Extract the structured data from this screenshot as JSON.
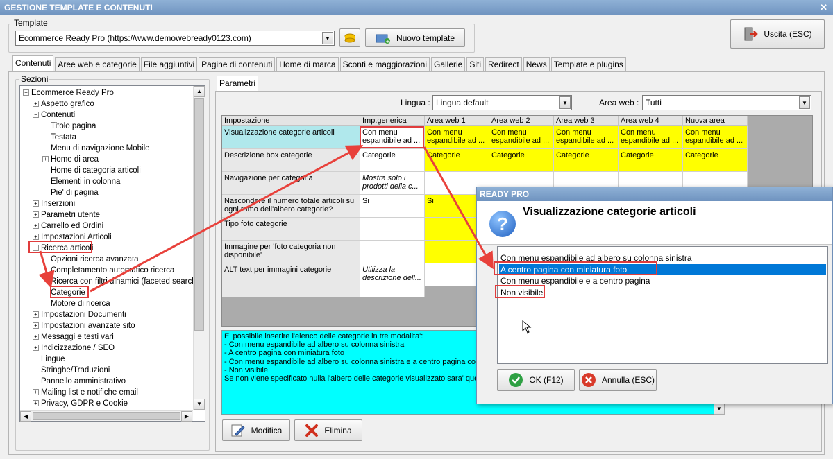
{
  "window": {
    "title": "GESTIONE TEMPLATE E CONTENUTI",
    "close": "✕"
  },
  "template": {
    "group_label": "Template",
    "selected": "Ecommerce Ready Pro (https://www.demowebready0123.com)",
    "new_button": "Nuovo template",
    "exit_button": "Uscita (ESC)"
  },
  "tabs": [
    "Contenuti",
    "Aree web e categorie",
    "File aggiuntivi",
    "Pagine di contenuti",
    "Home di marca",
    "Sconti e maggiorazioni",
    "Gallerie",
    "Siti",
    "Redirect",
    "News",
    "Template e plugins"
  ],
  "sections": {
    "label": "Sezioni",
    "tree": [
      {
        "label": "Ecommerce Ready Pro",
        "level": 0,
        "exp": "−"
      },
      {
        "label": "Aspetto grafico",
        "level": 1,
        "exp": "+"
      },
      {
        "label": "Contenuti",
        "level": 1,
        "exp": "−"
      },
      {
        "label": "Titolo pagina",
        "level": 2,
        "exp": ""
      },
      {
        "label": "Testata",
        "level": 2,
        "exp": ""
      },
      {
        "label": "Menu di navigazione Mobile",
        "level": 2,
        "exp": ""
      },
      {
        "label": "Home di area",
        "level": 2,
        "exp": "+"
      },
      {
        "label": "Home di categoria articoli",
        "level": 2,
        "exp": ""
      },
      {
        "label": "Elementi in colonna",
        "level": 2,
        "exp": ""
      },
      {
        "label": "Pie' di pagina",
        "level": 2,
        "exp": ""
      },
      {
        "label": "Inserzioni",
        "level": 1,
        "exp": "+"
      },
      {
        "label": "Parametri utente",
        "level": 1,
        "exp": "+"
      },
      {
        "label": "Carrello ed Ordini",
        "level": 1,
        "exp": "+"
      },
      {
        "label": "Impostazioni Articoli",
        "level": 1,
        "exp": "+"
      },
      {
        "label": "Ricerca articoli",
        "level": 1,
        "exp": "−"
      },
      {
        "label": "Opzioni ricerca avanzata",
        "level": 2,
        "exp": ""
      },
      {
        "label": "Completamento automatico ricerca",
        "level": 2,
        "exp": ""
      },
      {
        "label": "Ricerca con filtri dinamici (faceted search)",
        "level": 2,
        "exp": ""
      },
      {
        "label": "Categorie",
        "level": 2,
        "exp": ""
      },
      {
        "label": "Motore di ricerca",
        "level": 2,
        "exp": ""
      },
      {
        "label": "Impostazioni Documenti",
        "level": 1,
        "exp": "+"
      },
      {
        "label": "Impostazioni avanzate sito",
        "level": 1,
        "exp": "+"
      },
      {
        "label": "Messaggi e testi vari",
        "level": 1,
        "exp": "+"
      },
      {
        "label": "Indicizzazione / SEO",
        "level": 1,
        "exp": "+"
      },
      {
        "label": "Lingue",
        "level": 1,
        "exp": ""
      },
      {
        "label": "Stringhe/Traduzioni",
        "level": 1,
        "exp": ""
      },
      {
        "label": "Pannello amministrativo",
        "level": 1,
        "exp": ""
      },
      {
        "label": "Mailing list e notifiche email",
        "level": 1,
        "exp": "+"
      },
      {
        "label": "Privacy, GDPR e Cookie",
        "level": 1,
        "exp": "+"
      }
    ]
  },
  "params": {
    "tab": "Parametri",
    "lingua_label": "Lingua :",
    "lingua_value": "Lingua default",
    "area_label": "Area web :",
    "area_value": "Tutti",
    "columns": [
      "Impostazione",
      "Imp.generica",
      "Area web 1",
      "Area web 2",
      "Area web 3",
      "Area web 4",
      "Nuova area"
    ],
    "rows": [
      {
        "name": "Visualizzazione categorie articoli",
        "generic": "Con menu espandibile ad ...",
        "areas": [
          "Con menu espandibile ad ...",
          "Con menu espandibile ad ...",
          "Con menu espandibile ad ...",
          "Con menu espandibile ad ...",
          "Con menu espandibile ad ..."
        ]
      },
      {
        "name": "Descrizione box categorie",
        "generic": "Categorie",
        "areas": [
          "Categorie",
          "Categorie",
          "Categorie",
          "Categorie",
          "Categorie"
        ]
      },
      {
        "name": "Navigazione per categoria",
        "generic": "Mostra solo i prodotti della c...",
        "areas": [
          "",
          "",
          "",
          "",
          ""
        ]
      },
      {
        "name": "Nascondere il numero totale articoli su ogni ramo dell'albero categorie?",
        "generic": "Si",
        "areas": [
          "Si",
          "",
          "",
          "",
          ""
        ]
      },
      {
        "name": "Tipo foto categorie",
        "generic": "",
        "areas": [
          "",
          "",
          "",
          "",
          ""
        ]
      },
      {
        "name": "Immagine per 'foto categoria non disponibile'",
        "generic": "",
        "areas": [
          "",
          "",
          "",
          "",
          ""
        ]
      },
      {
        "name": "ALT text per immagini categorie",
        "generic": "Utilizza la descrizione dell...",
        "areas": [
          "",
          "",
          "",
          "",
          ""
        ]
      }
    ],
    "description": [
      "E' possibile inserire l'elenco delle categorie in tre modalita':",
      "- Con menu espandibile ad albero su colonna sinistra",
      "- A centro pagina con miniatura foto",
      "- Con menu espandibile ad albero su colonna sinistra e a centro pagina con m",
      "- Non visibile",
      "Se non viene specificato nulla l'albero delle categorie visualizzato sara' quello"
    ],
    "edit_button": "Modifica",
    "delete_button": "Elimina"
  },
  "dialog": {
    "title": "READY PRO",
    "heading": "Visualizzazione categorie articoli",
    "options": [
      "Con menu espandibile ad albero su colonna sinistra",
      "A centro pagina con miniatura foto",
      "Con menu espandibile e a centro pagina",
      "Non visibile"
    ],
    "selected_index": 1,
    "ok_button": "OK (F12)",
    "cancel_button": "Annulla (ESC)"
  },
  "colors": {
    "accent": "#0078d7",
    "highlight_red": "#e03c3c",
    "yellow": "#ffff00",
    "cyan": "#00ffff",
    "selected_row": "#b0e8ec"
  }
}
